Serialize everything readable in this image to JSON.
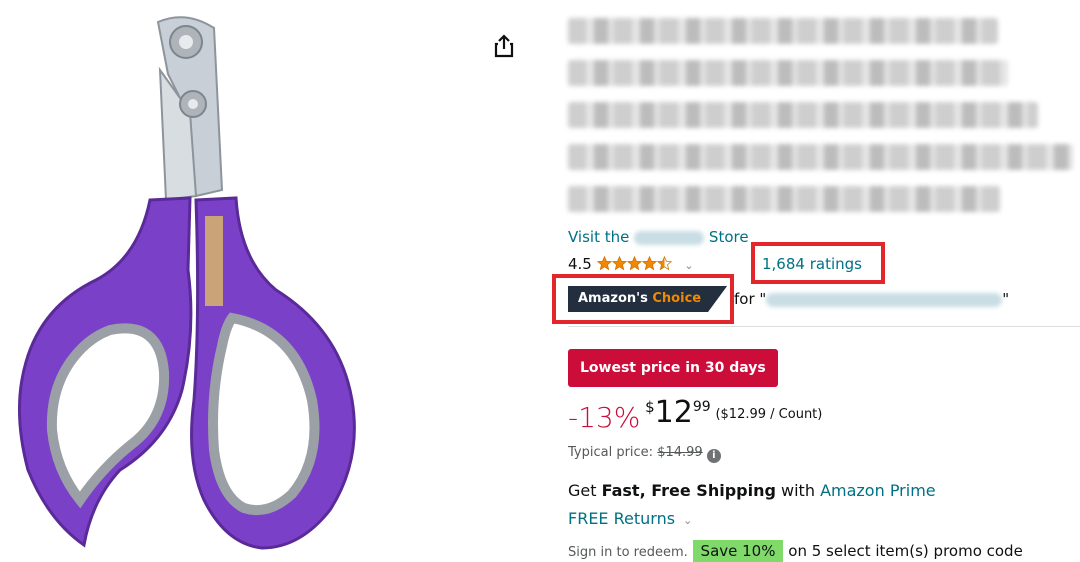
{
  "product": {
    "image_alt": "Purple pet nail scissors",
    "title_lines_blurred": 6
  },
  "store": {
    "prefix": "Visit the",
    "suffix": "Store"
  },
  "rating": {
    "value": "4.5",
    "ratings_text": "1,684 ratings"
  },
  "choice": {
    "badge_prefix": "Amazon's",
    "badge_highlight": "Choice",
    "for_text": "for \"",
    "end_quote": "\""
  },
  "deal": {
    "badge": "Lowest price in 30 days"
  },
  "price": {
    "discount": "-13%",
    "symbol": "$",
    "whole": "12",
    "fraction": "99",
    "per_unit": "($12.99 / Count)",
    "typical_label": "Typical price:",
    "typical_value": "$14.99"
  },
  "shipping": {
    "prefix": "Get",
    "bold": "Fast, Free Shipping",
    "middle": "with",
    "link": "Amazon Prime"
  },
  "returns": {
    "label": "FREE Returns"
  },
  "promo": {
    "prefix": "Sign in to redeem.",
    "badge": "Save 10%",
    "suffix": "on 5 select item(s) promo code"
  },
  "colors": {
    "accent_link": "#007185",
    "deal_red": "#cc0c39",
    "highlight_box": "#e3262b",
    "badge_dark": "#232f3e",
    "star": "#f08804",
    "save_green": "#7fda69"
  },
  "icons": [
    "share-icon",
    "star-icon",
    "chevron-down-icon",
    "info-icon"
  ]
}
